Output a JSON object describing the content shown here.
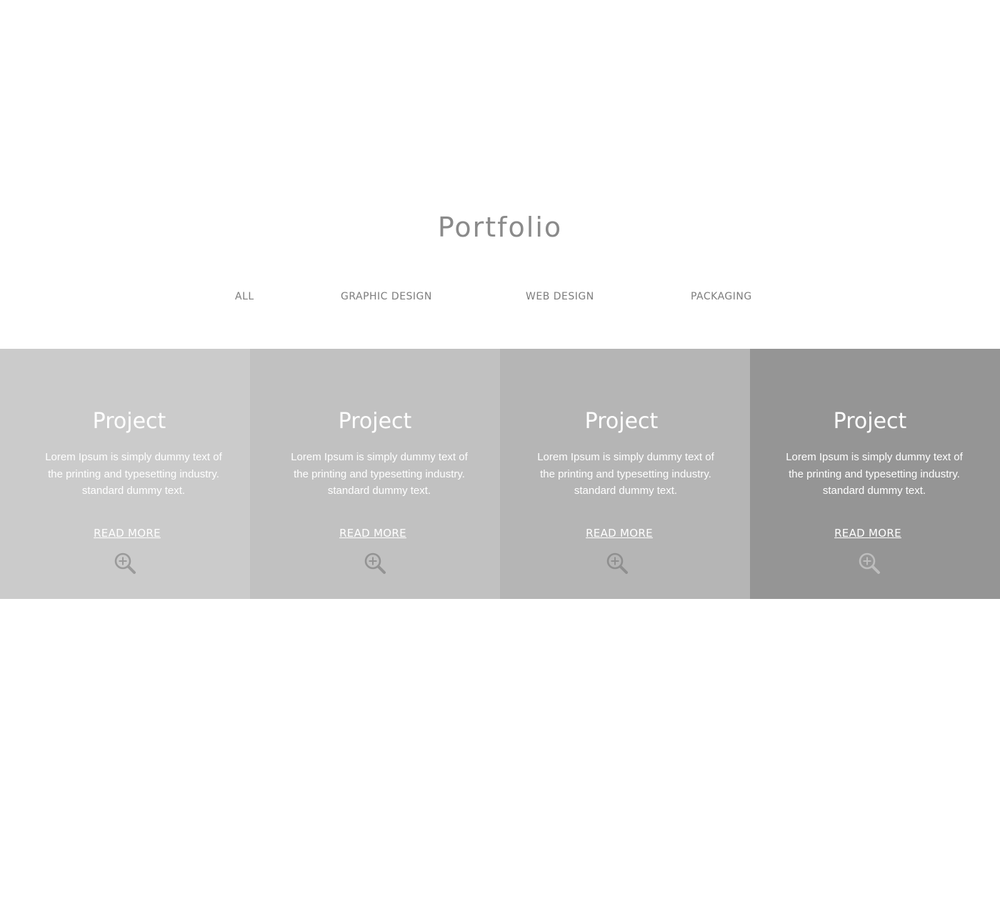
{
  "header": {
    "title": "Portfolio"
  },
  "filters": [
    {
      "label": "ALL"
    },
    {
      "label": "GRAPHIC DESIGN"
    },
    {
      "label": "WEB DESIGN"
    },
    {
      "label": "PACKAGING"
    }
  ],
  "cards": [
    {
      "title": "Project",
      "text": "Lorem Ipsum is simply dummy text of the printing and typesetting industry. standard dummy text.",
      "link_label": "READ MORE",
      "icon": "zoom-in-icon",
      "background": "#cbcbcb",
      "icon_color": "#9a9a9a"
    },
    {
      "title": "Project",
      "text": "Lorem Ipsum is simply dummy text of the printing and typesetting industry. standard dummy text.",
      "link_label": "READ MORE",
      "icon": "zoom-in-icon",
      "background": "#c1c1c1",
      "icon_color": "#939393"
    },
    {
      "title": "Project",
      "text": "Lorem Ipsum is simply dummy text of the printing and typesetting industry. standard dummy text.",
      "link_label": "READ MORE",
      "icon": "zoom-in-icon",
      "background": "#b5b5b5",
      "icon_color": "#8f8f8f"
    },
    {
      "title": "Project",
      "text": "Lorem Ipsum is simply dummy text of the printing and typesetting industry. standard dummy text.",
      "link_label": "READ MORE",
      "icon": "zoom-in-icon",
      "background": "#959595",
      "icon_color": "#bdbdbd"
    }
  ]
}
